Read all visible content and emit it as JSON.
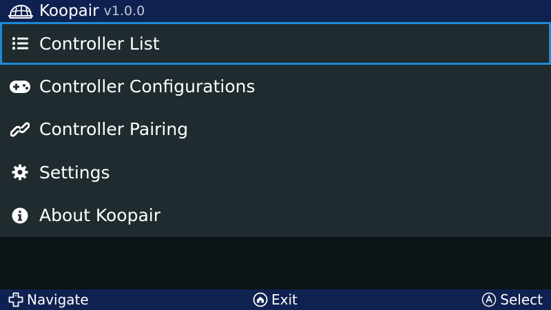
{
  "header": {
    "title": "Koopair",
    "version": "v1.0.0",
    "logo_icon": "koopa-shell-icon"
  },
  "menu": {
    "items": [
      {
        "label": "Controller List",
        "icon": "list-icon",
        "selected": true
      },
      {
        "label": "Controller Configurations",
        "icon": "gamepad-icon",
        "selected": false
      },
      {
        "label": "Controller Pairing",
        "icon": "link-icon",
        "selected": false
      },
      {
        "label": "Settings",
        "icon": "gear-icon",
        "selected": false
      },
      {
        "label": "About Koopair",
        "icon": "info-icon",
        "selected": false
      }
    ]
  },
  "footer": {
    "navigate": {
      "label": "Navigate",
      "icon": "dpad-icon"
    },
    "exit": {
      "label": "Exit",
      "icon": "home-button-icon"
    },
    "select": {
      "label": "Select",
      "icon": "a-button-icon"
    }
  },
  "colors": {
    "header_bg": "#0f2150",
    "menu_bg": "#1f2b2f",
    "screen_bg": "#0b1416",
    "selection_border": "#1c8bd6",
    "version_text": "#c3c8d2"
  }
}
